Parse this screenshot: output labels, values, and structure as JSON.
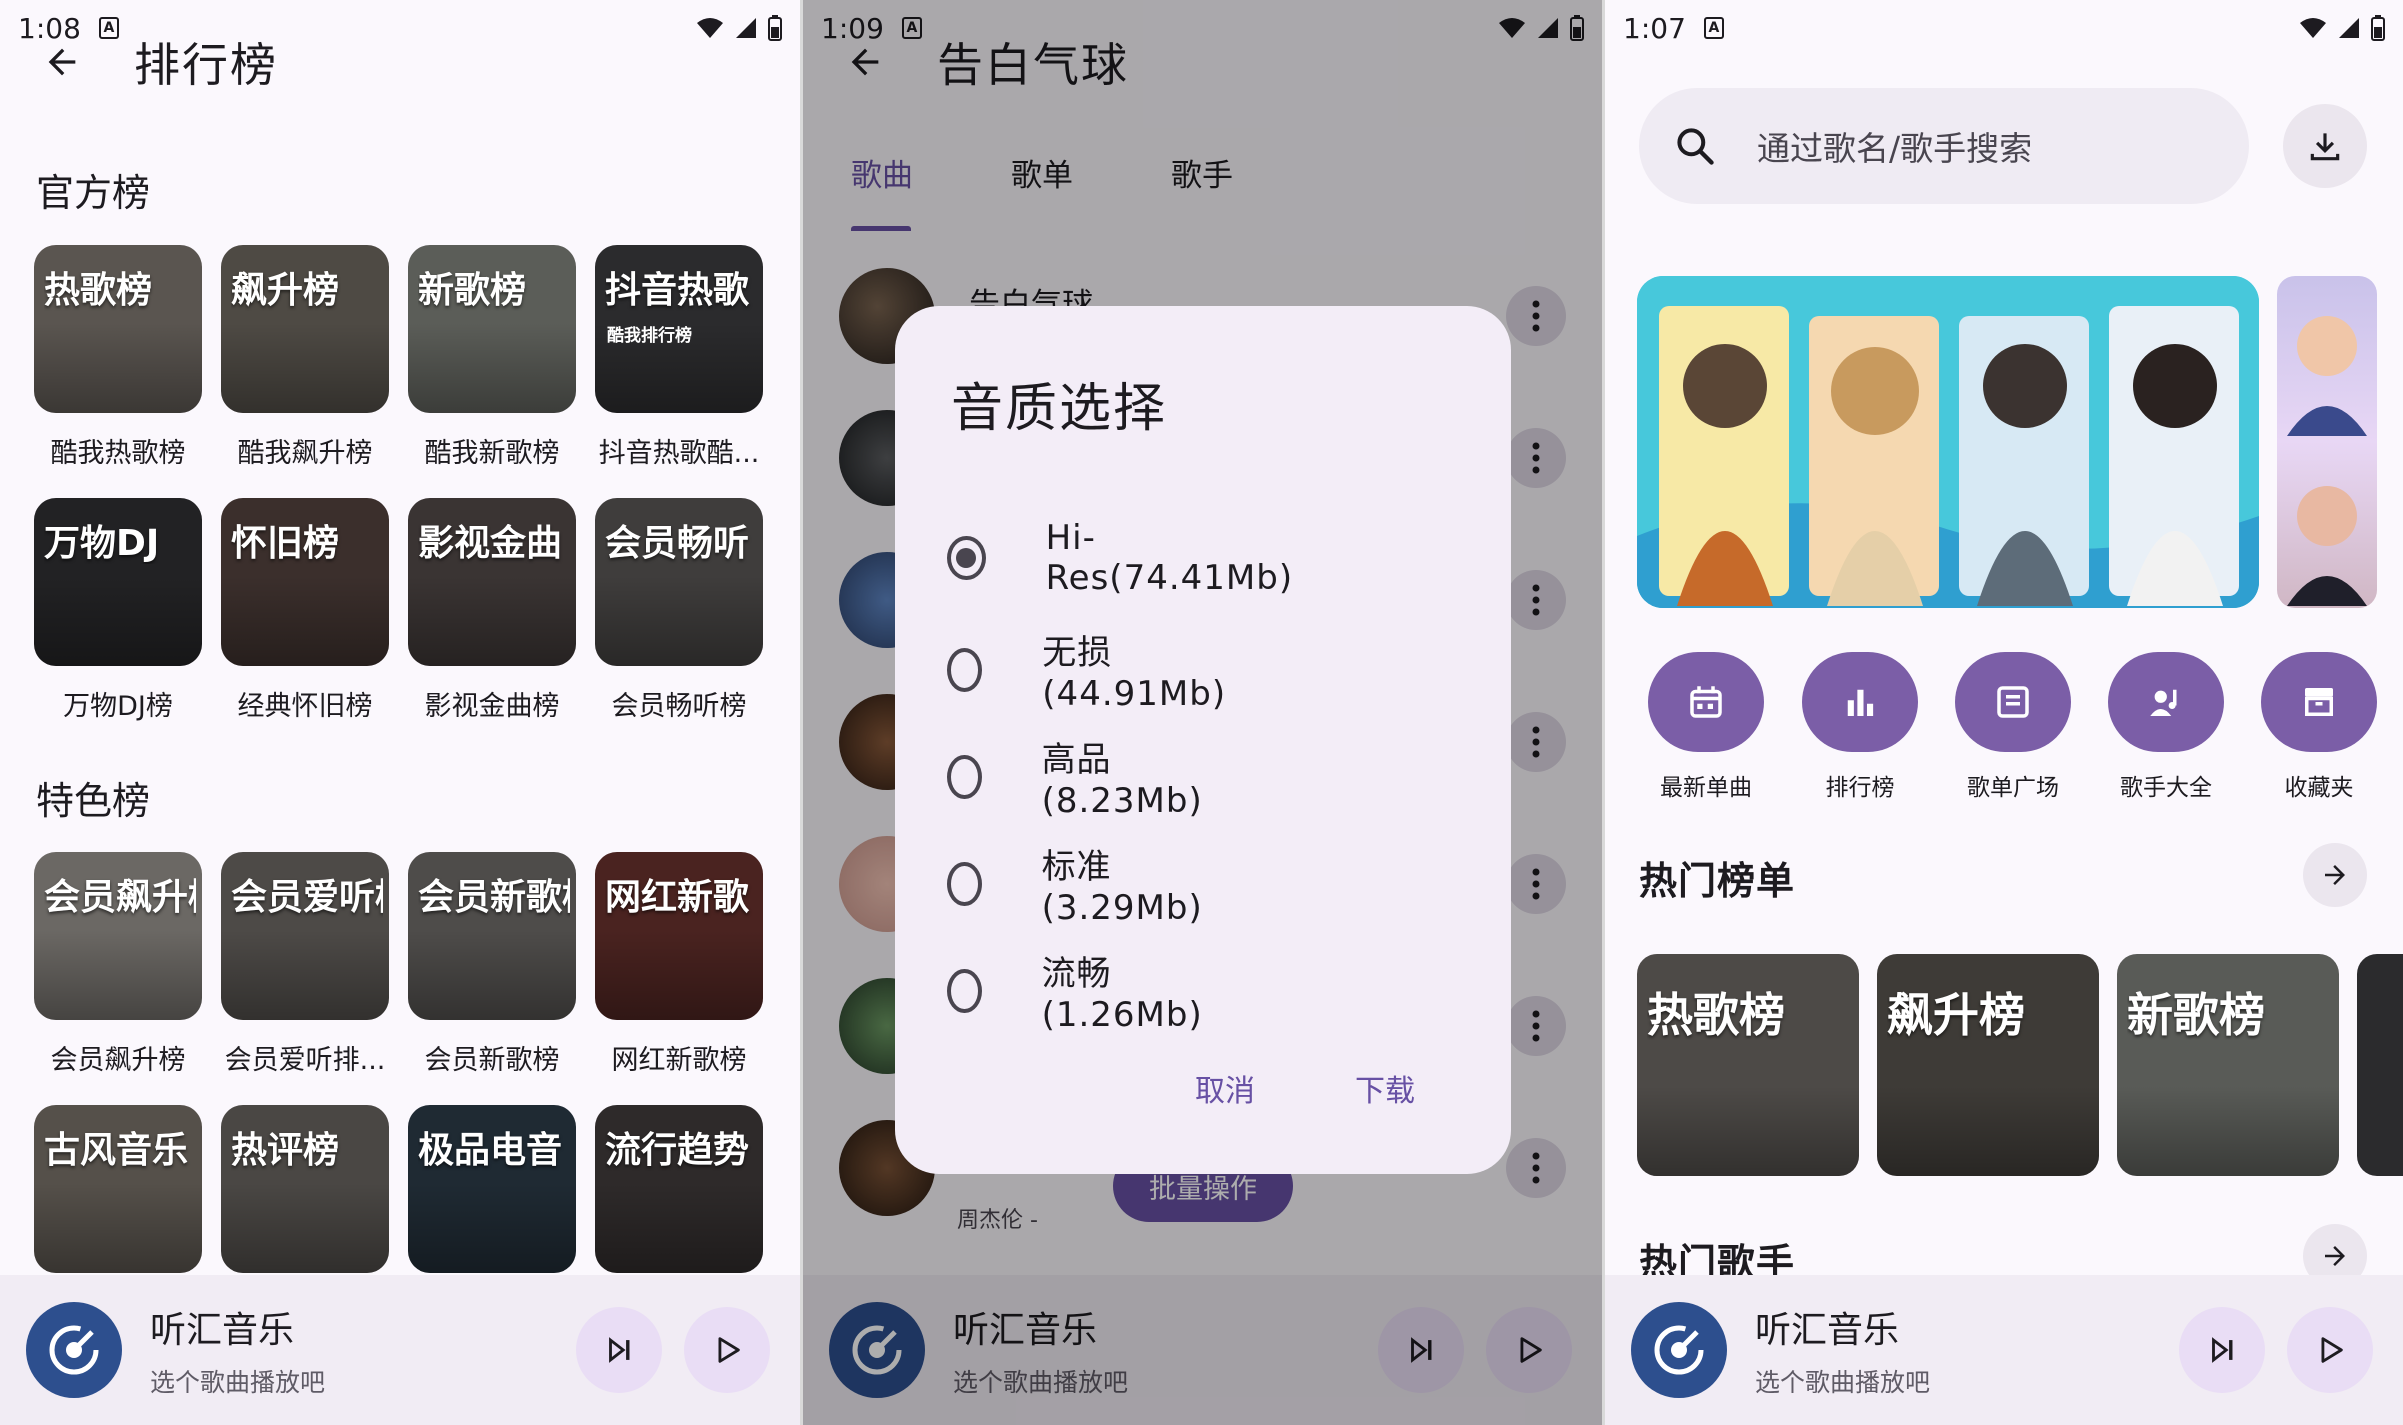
{
  "colors": {
    "accent": "#6750a4",
    "background": "#fbf8fd",
    "player_bg": "#f1ecf4",
    "disc": "#2d4f8e",
    "quick_action": "#7b5ea7"
  },
  "screen1": {
    "time": "1:08",
    "title": "排行榜",
    "official_title": "官方榜",
    "official": [
      {
        "cover": "热歌榜",
        "sub": "",
        "label": "酷我热歌榜",
        "color": "#5a5550"
      },
      {
        "cover": "飙升榜",
        "sub": "",
        "label": "酷我飙升榜",
        "color": "#4e4a44"
      },
      {
        "cover": "新歌榜",
        "sub": "",
        "label": "酷我新歌榜",
        "color": "#5b5d58"
      },
      {
        "cover": "抖音热歌",
        "sub": "酷我排行榜",
        "label": "抖音热歌酷...",
        "color": "#2b2b2d"
      },
      {
        "cover": "万物DJ",
        "sub": "",
        "label": "万物DJ榜",
        "color": "#222224"
      },
      {
        "cover": "怀旧榜",
        "sub": "",
        "label": "经典怀旧榜",
        "color": "#3b2f2c"
      },
      {
        "cover": "影视金曲",
        "sub": "",
        "label": "影视金曲榜",
        "color": "#3a3433"
      },
      {
        "cover": "会员畅听",
        "sub": "",
        "label": "会员畅听榜",
        "color": "#3f3d3c"
      }
    ],
    "feature_title": "特色榜",
    "feature": [
      {
        "cover": "会员飙升榜",
        "label": "会员飙升榜",
        "color": "#6b6864"
      },
      {
        "cover": "会员爱听榜",
        "label": "会员爱听排...",
        "color": "#4d4a47"
      },
      {
        "cover": "会员新歌榜",
        "label": "会员新歌榜",
        "color": "#4e4c4a"
      },
      {
        "cover": "网红新歌",
        "label": "网红新歌榜",
        "color": "#4a2320"
      },
      {
        "cover": "古风音乐",
        "label": "",
        "color": "#55504a"
      },
      {
        "cover": "热评榜",
        "label": "",
        "color": "#4a4744"
      },
      {
        "cover": "极品电音",
        "label": "",
        "color": "#1f2a33"
      },
      {
        "cover": "流行趋势",
        "label": "",
        "color": "#2e2a2a"
      }
    ]
  },
  "screen2": {
    "time": "1:09",
    "title": "告白气球",
    "tabs": [
      "歌曲",
      "歌单",
      "歌手"
    ],
    "first_song": "告白气球",
    "artist_partial": "周杰伦 -",
    "batch": "批量操作",
    "dialog": {
      "title": "音质选择",
      "options": [
        {
          "label": "Hi-Res(74.41Mb)",
          "selected": true
        },
        {
          "label": "无损(44.91Mb)",
          "selected": false
        },
        {
          "label": "高品(8.23Mb)",
          "selected": false
        },
        {
          "label": "标准(3.29Mb)",
          "selected": false
        },
        {
          "label": "流畅(1.26Mb)",
          "selected": false
        }
      ],
      "cancel": "取消",
      "confirm": "下载"
    }
  },
  "screen3": {
    "time": "1:07",
    "search_placeholder": "通过歌名/歌手搜索",
    "quick_actions": [
      {
        "label": "最新单曲",
        "icon": "calendar-icon"
      },
      {
        "label": "排行榜",
        "icon": "bar-chart-icon"
      },
      {
        "label": "歌单广场",
        "icon": "playlist-icon"
      },
      {
        "label": "歌手大全",
        "icon": "singer-icon"
      },
      {
        "label": "收藏夹",
        "icon": "inbox-icon"
      }
    ],
    "hot_charts_title": "热门榜单",
    "hot_charts": [
      {
        "cover": "热歌榜",
        "color": "#4d4a47"
      },
      {
        "cover": "飙升榜",
        "color": "#3e3b37"
      },
      {
        "cover": "新歌榜",
        "color": "#595b57"
      }
    ],
    "hot_singers_title": "热门歌手"
  },
  "player": {
    "title": "听汇音乐",
    "subtitle": "选个歌曲播放吧"
  }
}
